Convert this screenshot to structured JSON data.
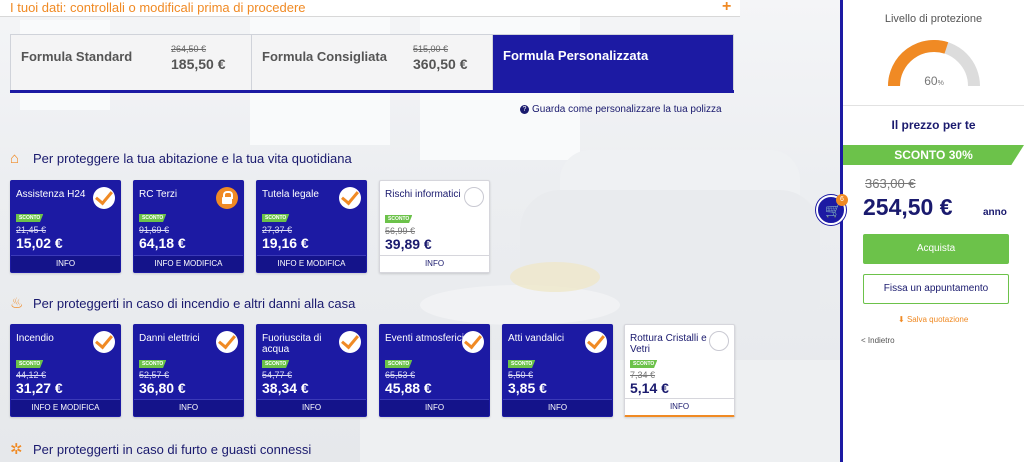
{
  "header": {
    "title": "I tuoi dati: controllali o modificali prima di procedere",
    "expand_icon": "plus-icon"
  },
  "formulas": [
    {
      "name": "Formula Standard",
      "old_price": "264,50 €",
      "price": "185,50 €"
    },
    {
      "name": "Formula Consigliata",
      "old_price": "515,00 €",
      "price": "360,50 €"
    },
    {
      "name": "Formula Personalizzata",
      "active": true
    }
  ],
  "guide_link": "Guarda come personalizzare la tua polizza",
  "sections": [
    {
      "title": "Per proteggere la tua abitazione e la tua vita quotidiana",
      "icon": "house-icon",
      "cards": [
        {
          "title": "Assistenza H24",
          "badge": "SCONTO",
          "old": "21,45 €",
          "price": "15,02 €",
          "footer": "INFO",
          "state": "checked"
        },
        {
          "title": "RC Terzi",
          "badge": "SCONTO",
          "old": "91,69 €",
          "price": "64,18 €",
          "footer": "INFO E MODIFICA",
          "state": "locked"
        },
        {
          "title": "Tutela legale",
          "badge": "SCONTO",
          "old": "27,37 €",
          "price": "19,16 €",
          "footer": "INFO E MODIFICA",
          "state": "checked"
        },
        {
          "title": "Rischi informatici",
          "badge": "SCONTO",
          "old": "56,99 €",
          "price": "39,89 €",
          "footer": "INFO",
          "state": "unchecked"
        }
      ]
    },
    {
      "title": "Per proteggerti in caso di incendio e altri danni alla casa",
      "icon": "fire-icon",
      "cards": [
        {
          "title": "Incendio",
          "badge": "SCONTO",
          "old": "44,12 €",
          "price": "31,27 €",
          "footer": "INFO E MODIFICA",
          "state": "checked"
        },
        {
          "title": "Danni elettrici",
          "badge": "SCONTO",
          "old": "52,57 €",
          "price": "36,80 €",
          "footer": "INFO",
          "state": "checked"
        },
        {
          "title": "Fuoriuscita di acqua",
          "badge": "SCONTO",
          "old": "54,77 €",
          "price": "38,34 €",
          "footer": "INFO",
          "state": "checked"
        },
        {
          "title": "Eventi atmosferici",
          "badge": "SCONTO",
          "old": "65,53 €",
          "price": "45,88 €",
          "footer": "INFO",
          "state": "checked"
        },
        {
          "title": "Atti vandalici",
          "badge": "SCONTO",
          "old": "5,50 €",
          "price": "3,85 €",
          "footer": "INFO",
          "state": "checked"
        },
        {
          "title": "Rottura Cristalli e Vetri",
          "badge": "SCONTO",
          "old": "7,34 €",
          "price": "5,14 €",
          "footer": "INFO",
          "state": "unchecked"
        }
      ]
    },
    {
      "title": "Per proteggerti in caso di furto e guasti connessi",
      "icon": "theft-icon"
    }
  ],
  "panel": {
    "level_label": "Livello di protezione",
    "level_value": "60",
    "level_unit": "%",
    "level_fraction": 0.6,
    "price_label": "Il prezzo per te",
    "discount": "SCONTO 30%",
    "old_total": "363,00 €",
    "total": "254,50 €",
    "period": "anno",
    "cart_count": "6",
    "buy_label": "Acquista",
    "appointment_label": "Fissa un appuntamento",
    "save_label": "Salva quotazione",
    "back_label": "< Indietro"
  },
  "colors": {
    "brand_blue": "#1c1aa3",
    "accent_orange": "#f08a24",
    "discount_green": "#6cc24a"
  }
}
